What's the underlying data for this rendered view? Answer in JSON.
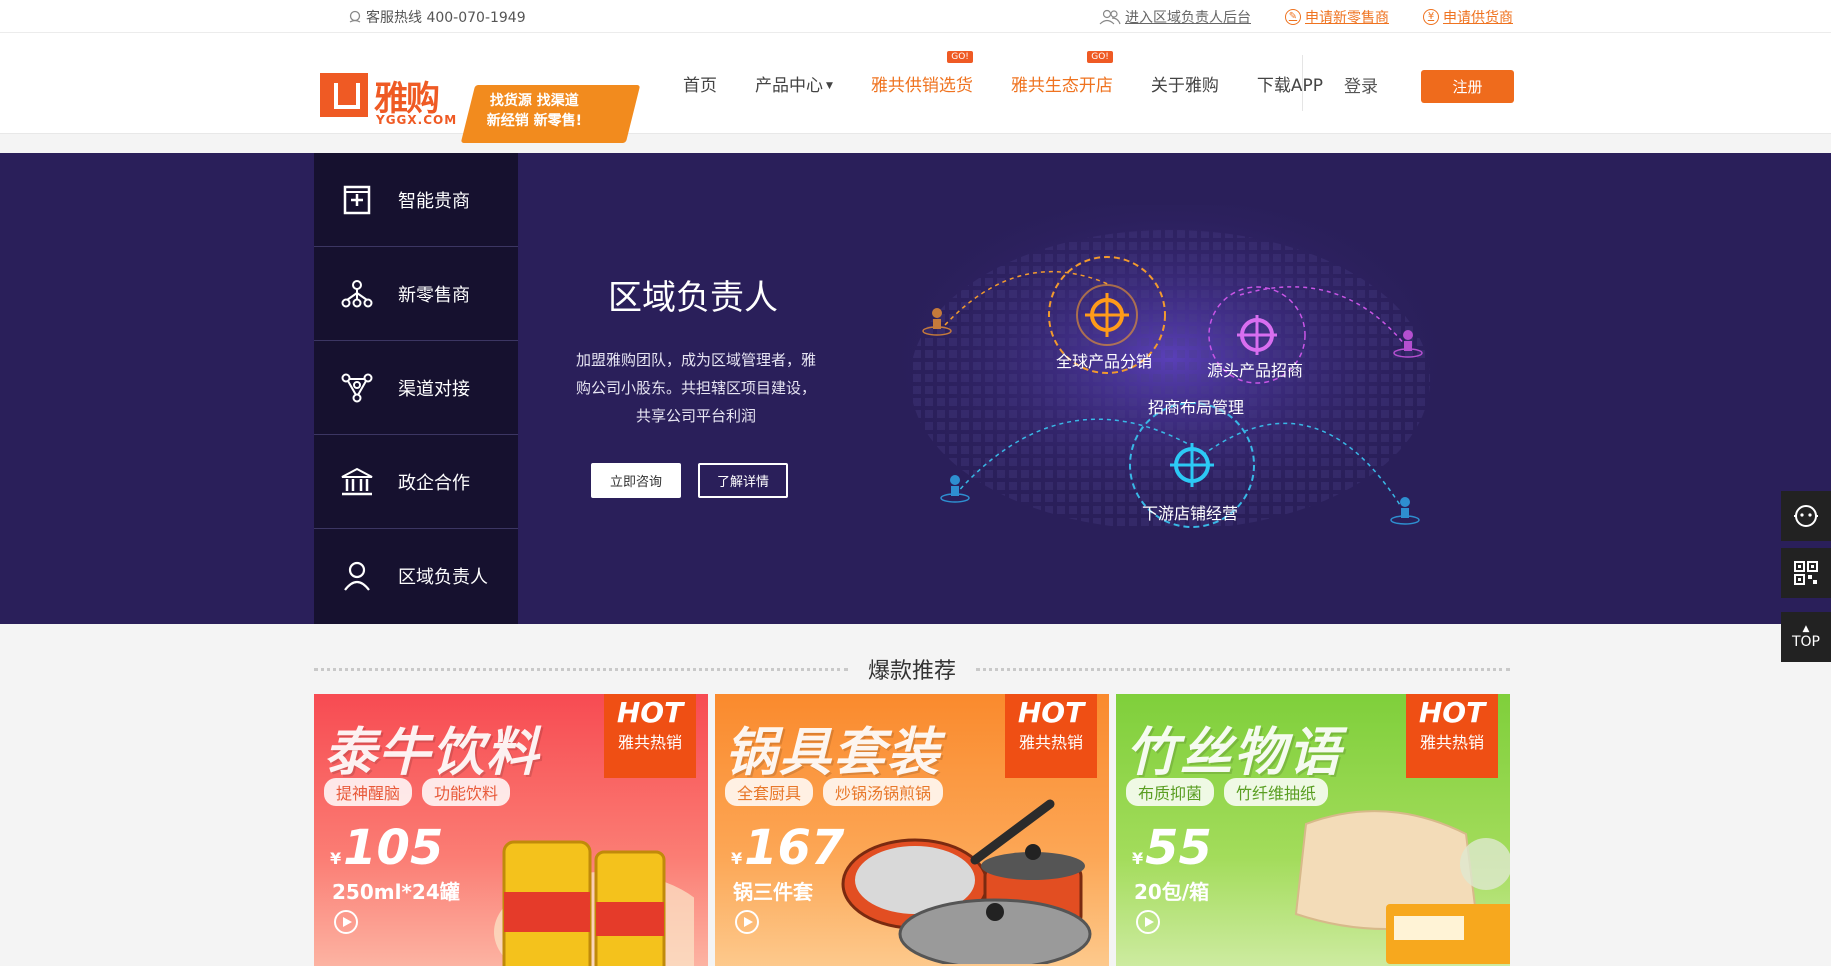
{
  "topbar": {
    "hotline": "客服热线 400-070-1949",
    "links": [
      "进入区域负责人后台",
      "申请新零售商",
      "申请供货商"
    ]
  },
  "header": {
    "logo_cn": "雅购",
    "logo_en": "YGGX.COM",
    "slogan_line1": "找货源 找渠道",
    "slogan_line2": "新经销 新零售!",
    "nav": [
      "首页",
      "产品中心",
      "雅共供销选货",
      "雅共生态开店",
      "关于雅购",
      "下载APP"
    ],
    "go_badge": "GO!",
    "login": "登录",
    "register": "注册"
  },
  "banner": {
    "menu": [
      "智能贵商",
      "新零售商",
      "渠道对接",
      "政企合作",
      "区域负责人"
    ],
    "title": "区域负责人",
    "desc": "加盟雅购团队，成为区域管理者，雅购公司小股东。共担辖区项目建设，共享公司平台利润",
    "btn_consult": "立即咨询",
    "btn_detail": "了解详情",
    "map_labels": [
      "全球产品分销",
      "源头产品招商",
      "招商布局管理",
      "下游店铺经营"
    ]
  },
  "float": {
    "top": "TOP"
  },
  "section": {
    "title": "爆款推荐"
  },
  "cards": [
    {
      "name": "泰牛饮料",
      "hot": "HOT",
      "hot_sub": "雅共热销",
      "tag1": "提神醒脑",
      "tag2": "功能饮料",
      "currency": "¥",
      "price": "105",
      "spec": "250ml*24罐",
      "color_top": "#f74b52",
      "color_bottom": "#fb8f86",
      "tag_color": "#e85a3a"
    },
    {
      "name": "锅具套装",
      "hot": "HOT",
      "hot_sub": "雅共热销",
      "tag1": "全套厨具",
      "tag2": "炒锅汤锅煎锅",
      "currency": "¥",
      "price": "167",
      "spec": "锅三件套",
      "color_top": "#fa8a2d",
      "color_bottom": "#fcb86a",
      "tag_color": "#e8782a"
    },
    {
      "name": "竹丝物语",
      "hot": "HOT",
      "hot_sub": "雅共热销",
      "tag1": "布质抑菌",
      "tag2": "竹纤维抽纸",
      "currency": "¥",
      "price": "55",
      "spec": "20包/箱",
      "color_top": "#7fcf3b",
      "color_bottom": "#b5e46c",
      "tag_color": "#5a9e22"
    }
  ]
}
